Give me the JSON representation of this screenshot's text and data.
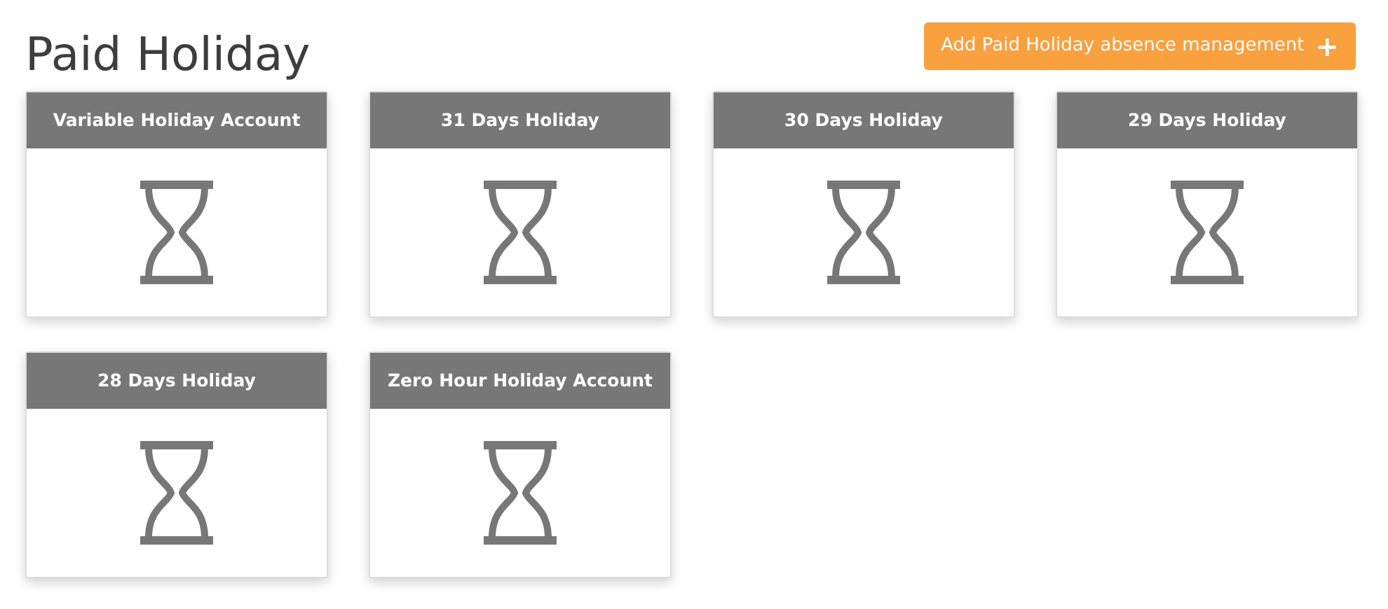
{
  "page_title": "Paid Holiday",
  "add_button": {
    "label": "Add Paid Holiday absence management",
    "icon": "+"
  },
  "cards": [
    {
      "title": "Variable Holiday Account"
    },
    {
      "title": "31 Days Holiday"
    },
    {
      "title": "30 Days Holiday"
    },
    {
      "title": "29 Days Holiday"
    },
    {
      "title": "28 Days Holiday"
    },
    {
      "title": "Zero Hour Holiday Account"
    }
  ]
}
